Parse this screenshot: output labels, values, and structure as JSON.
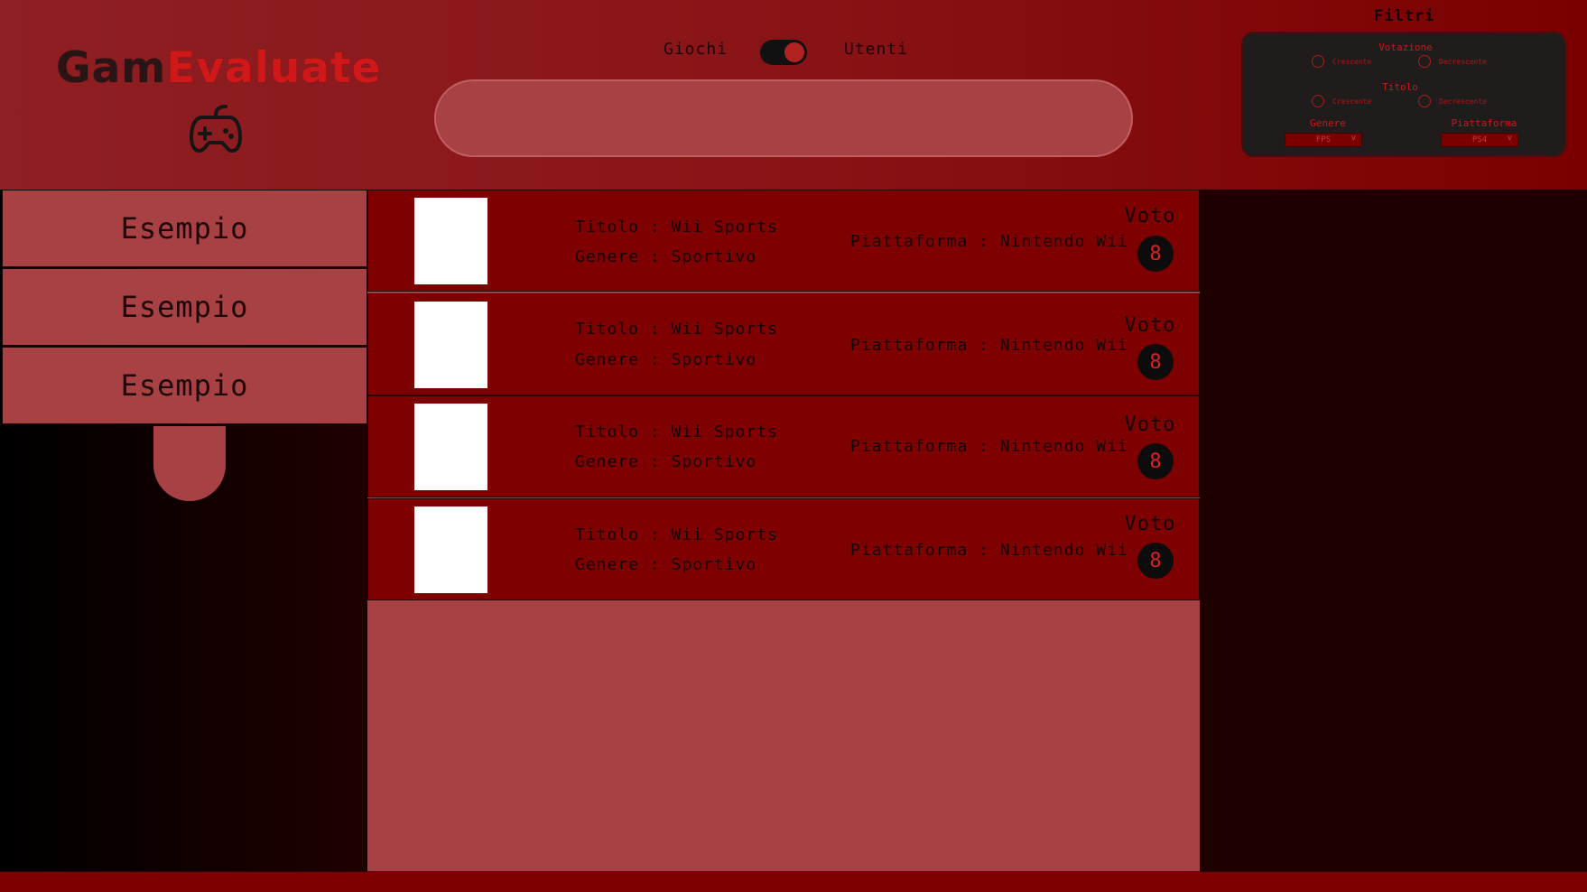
{
  "header": {
    "logo_part1": "Gam",
    "logo_part2": "Evaluate",
    "logo_icon": "gamepad-icon",
    "toggle_left": "Giochi",
    "toggle_right": "Utenti",
    "toggle_on": true,
    "search_placeholder": ""
  },
  "filters": {
    "title": "Filtri",
    "votazione": {
      "label": "Votazione",
      "opt1": "Crescente",
      "opt2": "Decrescente"
    },
    "titolo": {
      "label": "Titolo",
      "opt1": "Crescente",
      "opt2": "Decrescente"
    },
    "genere": {
      "label": "Genere",
      "value": "FPS"
    },
    "piattaforma": {
      "label": "Piattaforma",
      "value": "PS4"
    }
  },
  "sidebar": {
    "items": [
      {
        "label": "Esempio"
      },
      {
        "label": "Esempio"
      },
      {
        "label": "Esempio"
      }
    ]
  },
  "games": [
    {
      "titolo": "Titolo : Wii Sports",
      "genere": "Genere : Sportivo",
      "piattaforma": "Piattaforma : Nintendo Wii",
      "voto_label": "Voto",
      "voto": "8"
    },
    {
      "titolo": "Titolo : Wii Sports",
      "genere": "Genere : Sportivo",
      "piattaforma": "Piattaforma : Nintendo Wii",
      "voto_label": "Voto",
      "voto": "8"
    },
    {
      "titolo": "Titolo : Wii Sports",
      "genere": "Genere : Sportivo",
      "piattaforma": "Piattaforma : Nintendo Wii",
      "voto_label": "Voto",
      "voto": "8"
    },
    {
      "titolo": "Titolo : Wii Sports",
      "genere": "Genere : Sportivo",
      "piattaforma": "Piattaforma : Nintendo Wii",
      "voto_label": "Voto",
      "voto": "8"
    }
  ],
  "colors": {
    "header_bg": "#8a1518",
    "panel_bg": "#a84144",
    "row_bg": "#7f0000",
    "accent_red": "#d11818",
    "filters_bg": "#211c1c"
  }
}
